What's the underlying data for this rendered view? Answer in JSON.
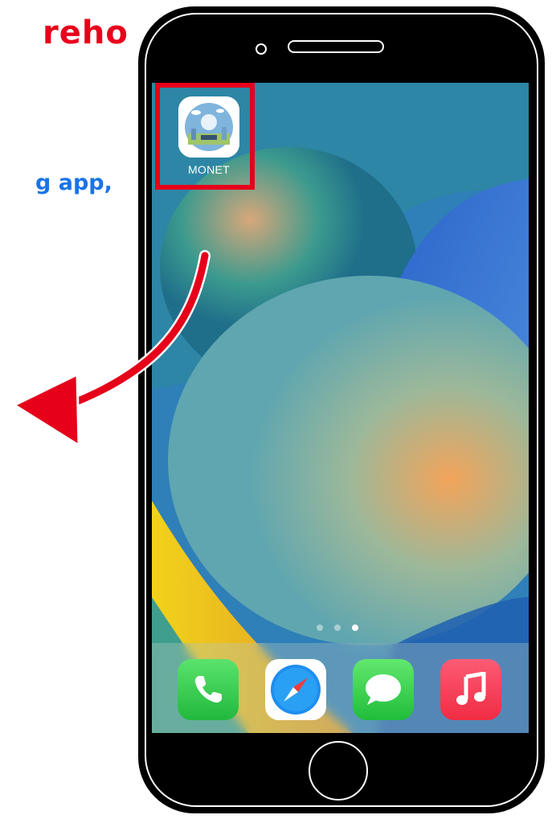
{
  "instruction": {
    "headline": "reho",
    "headline_color": "#e8001c",
    "subline": "g app,",
    "subline_color": "#1a73e8"
  },
  "home_screen": {
    "app_label": "MONET",
    "page_dots": 3,
    "active_page": 3
  },
  "dock": {
    "apps": [
      "phone-icon",
      "safari-icon",
      "messages-icon",
      "music-icon"
    ]
  },
  "colors": {
    "highlight": "#e6001a",
    "arrow": "#e6001a",
    "phone_green": "#34c759",
    "music_red": "#f93d55"
  }
}
